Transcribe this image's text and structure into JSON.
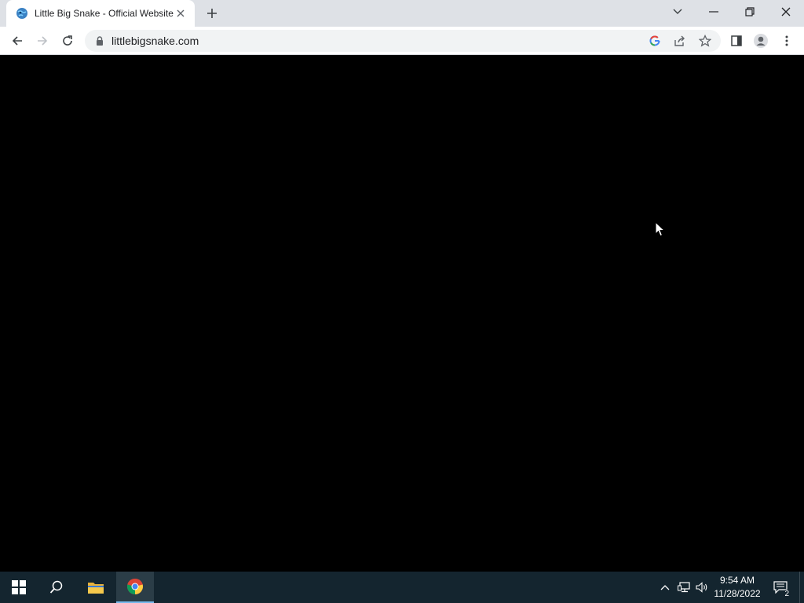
{
  "browser": {
    "tab": {
      "title": "Little Big Snake - Official Website"
    },
    "address_bar": {
      "url": "littlebigsnake.com"
    }
  },
  "taskbar": {
    "clock": {
      "time": "9:54 AM",
      "date": "11/28/2022"
    },
    "notifications": {
      "count": "2"
    }
  },
  "colors": {
    "page_background": "#000000",
    "taskbar_background": "#14252f",
    "tabstrip_background": "#dee1e6"
  }
}
